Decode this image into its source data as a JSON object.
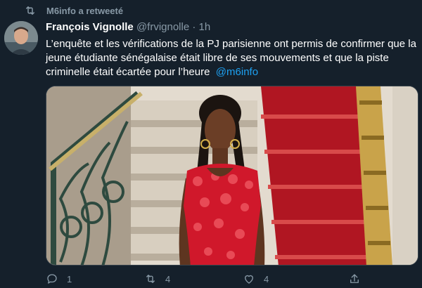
{
  "retweet": {
    "label": "M6info a retweeté",
    "icon": "retweet-icon"
  },
  "tweet": {
    "author_name": "François Vignolle",
    "author_handle": "@frvignolle",
    "separator": "·",
    "time": "1h",
    "text": "L’enquête et les vérifications de la PJ parisienne ont permis de confirmer que la jeune étudiante sénégalaise était libre de ses mouvements et que la piste criminelle était écartée pour l’heure",
    "mention": "@m6info"
  },
  "actions": {
    "reply_count": "1",
    "retweet_count": "4",
    "like_count": "4",
    "icons": [
      "reply-icon",
      "retweet-icon",
      "like-icon",
      "share-icon"
    ]
  },
  "colors": {
    "background": "#15202b",
    "secondary_text": "#8899a6",
    "link": "#1da1f2",
    "dress_red": "#d0182b"
  }
}
